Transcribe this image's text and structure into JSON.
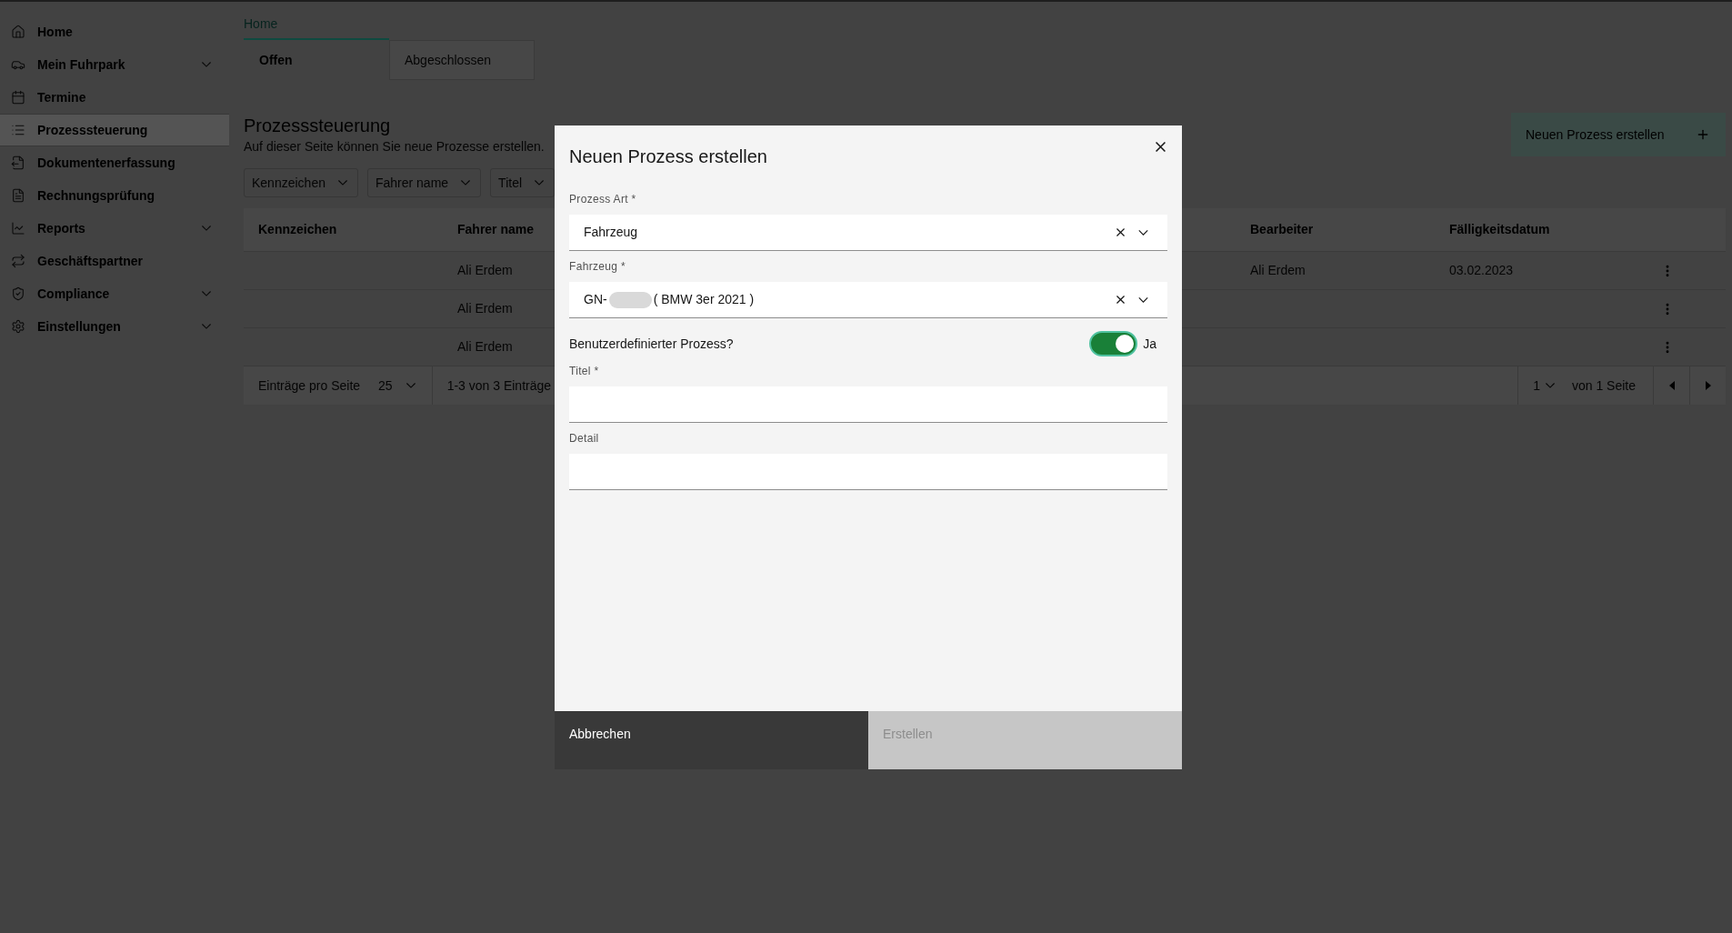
{
  "sidebar": {
    "items": [
      {
        "label": "Home",
        "expandable": false,
        "selected": false
      },
      {
        "label": "Mein Fuhrpark",
        "expandable": true,
        "selected": false
      },
      {
        "label": "Termine",
        "expandable": false,
        "selected": false
      },
      {
        "label": "Prozesssteuerung",
        "expandable": false,
        "selected": true
      },
      {
        "label": "Dokumentenerfassung",
        "expandable": false,
        "selected": false
      },
      {
        "label": "Rechnungsprüfung",
        "expandable": false,
        "selected": false
      },
      {
        "label": "Reports",
        "expandable": true,
        "selected": false
      },
      {
        "label": "Geschäftspartner",
        "expandable": false,
        "selected": false
      },
      {
        "label": "Compliance",
        "expandable": true,
        "selected": false
      },
      {
        "label": "Einstellungen",
        "expandable": true,
        "selected": false
      }
    ]
  },
  "top_tabs": [
    {
      "label": "Home",
      "selected": true
    }
  ],
  "status_tabs": [
    {
      "label": "Offen",
      "selected": true
    },
    {
      "label": "Abgeschlossen",
      "selected": false
    }
  ],
  "page_header": {
    "title": "Prozesssteuerung",
    "subtitle": "Auf dieser Seite können Sie neue Prozesse erstellen.",
    "create_button": "Neuen Prozess erstellen"
  },
  "filters": [
    {
      "label": "Kennzeichen"
    },
    {
      "label": "Fahrer name"
    },
    {
      "label": "Titel"
    }
  ],
  "table": {
    "columns": [
      "Kennzeichen",
      "Fahrer name",
      "Bearbeiter",
      "Fälligkeitsdatum"
    ],
    "rows": [
      {
        "fahrer_name": "Ali Erdem",
        "bearbeiter": "Ali Erdem",
        "faelligkeitsdatum": "03.02.2023"
      },
      {
        "fahrer_name": "Ali Erdem"
      },
      {
        "fahrer_name": "Ali Erdem"
      }
    ]
  },
  "pagination": {
    "per_page_label": "Einträge pro Seite",
    "per_page": "25",
    "range": "1-3 von 3 Einträge",
    "page": "1",
    "page_of": "von 1 Seite"
  },
  "modal": {
    "title": "Neuen Prozess erstellen",
    "fields": [
      {
        "kind": "select",
        "label": "Prozess Art *",
        "value": "Fahrzeug"
      },
      {
        "kind": "select",
        "label": "Fahrzeug *",
        "value_prefix": "GN-",
        "redacted": true,
        "value": "( BMW 3er 2021 )"
      },
      {
        "kind": "toggle",
        "label": "Benutzerdefinierter Prozess?",
        "on": true,
        "state_label": "Ja"
      },
      {
        "kind": "text",
        "label": "Titel *"
      },
      {
        "kind": "text",
        "label": "Detail"
      }
    ],
    "buttons": [
      {
        "label": "Abbrechen",
        "kind": "secondary",
        "disabled": false
      },
      {
        "label": "Erstellen",
        "kind": "primary",
        "disabled": true
      }
    ]
  }
}
